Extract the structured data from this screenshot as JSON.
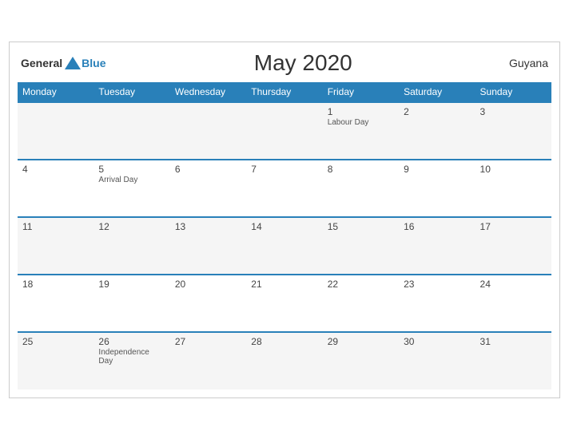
{
  "header": {
    "logo_general": "General",
    "logo_blue": "Blue",
    "title": "May 2020",
    "country": "Guyana"
  },
  "days_of_week": [
    "Monday",
    "Tuesday",
    "Wednesday",
    "Thursday",
    "Friday",
    "Saturday",
    "Sunday"
  ],
  "weeks": [
    [
      {
        "day": "",
        "event": ""
      },
      {
        "day": "",
        "event": ""
      },
      {
        "day": "",
        "event": ""
      },
      {
        "day": "",
        "event": ""
      },
      {
        "day": "1",
        "event": "Labour Day"
      },
      {
        "day": "2",
        "event": ""
      },
      {
        "day": "3",
        "event": ""
      }
    ],
    [
      {
        "day": "4",
        "event": ""
      },
      {
        "day": "5",
        "event": "Arrival Day"
      },
      {
        "day": "6",
        "event": ""
      },
      {
        "day": "7",
        "event": ""
      },
      {
        "day": "8",
        "event": ""
      },
      {
        "day": "9",
        "event": ""
      },
      {
        "day": "10",
        "event": ""
      }
    ],
    [
      {
        "day": "11",
        "event": ""
      },
      {
        "day": "12",
        "event": ""
      },
      {
        "day": "13",
        "event": ""
      },
      {
        "day": "14",
        "event": ""
      },
      {
        "day": "15",
        "event": ""
      },
      {
        "day": "16",
        "event": ""
      },
      {
        "day": "17",
        "event": ""
      }
    ],
    [
      {
        "day": "18",
        "event": ""
      },
      {
        "day": "19",
        "event": ""
      },
      {
        "day": "20",
        "event": ""
      },
      {
        "day": "21",
        "event": ""
      },
      {
        "day": "22",
        "event": ""
      },
      {
        "day": "23",
        "event": ""
      },
      {
        "day": "24",
        "event": ""
      }
    ],
    [
      {
        "day": "25",
        "event": ""
      },
      {
        "day": "26",
        "event": "Independence Day"
      },
      {
        "day": "27",
        "event": ""
      },
      {
        "day": "28",
        "event": ""
      },
      {
        "day": "29",
        "event": ""
      },
      {
        "day": "30",
        "event": ""
      },
      {
        "day": "31",
        "event": ""
      }
    ]
  ]
}
